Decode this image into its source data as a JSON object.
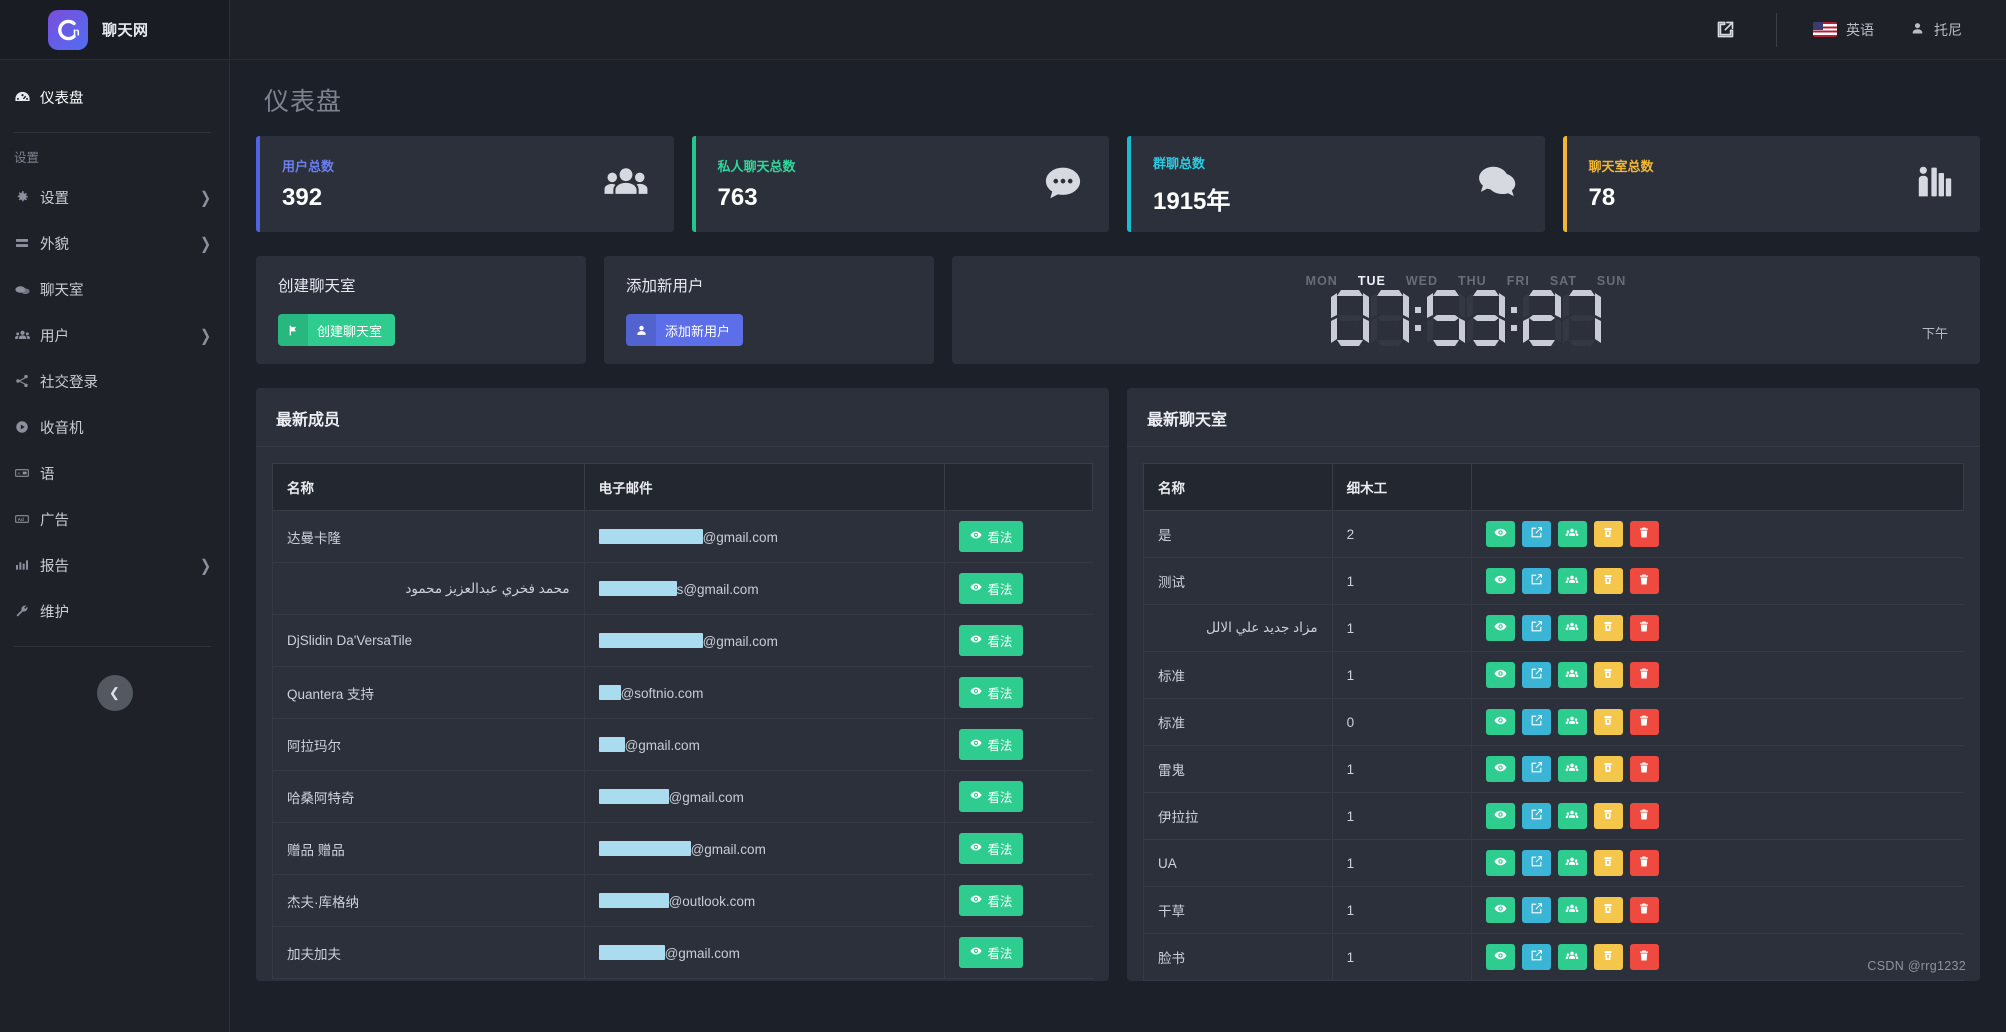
{
  "brand": {
    "title": "聊天网",
    "logo_text": "Cn",
    "logo_icon": "cn-logo-icon"
  },
  "topbar": {
    "external_icon": "external-link-icon",
    "language": "英语",
    "flag_icon": "us-flag-icon",
    "user_icon": "user-avatar-icon",
    "user": "托尼"
  },
  "sidebar": {
    "section_label": "设置",
    "collapse_icon": "chevron-left-icon",
    "items": [
      {
        "label": "仪表盘",
        "icon": "dashboard-icon",
        "active": true,
        "chevron": false
      },
      {
        "label": "设置",
        "icon": "gear-icon",
        "active": false,
        "chevron": true
      },
      {
        "label": "外貌",
        "icon": "appearance-icon",
        "active": false,
        "chevron": true
      },
      {
        "label": "聊天室",
        "icon": "chat-icon",
        "active": false,
        "chevron": false
      },
      {
        "label": "用户",
        "icon": "users-icon",
        "active": false,
        "chevron": true
      },
      {
        "label": "社交登录",
        "icon": "share-icon",
        "active": false,
        "chevron": false
      },
      {
        "label": "收音机",
        "icon": "radio-play-icon",
        "active": false,
        "chevron": false
      },
      {
        "label": "语",
        "icon": "language-icon",
        "active": false,
        "chevron": false
      },
      {
        "label": "广告",
        "icon": "ads-icon",
        "active": false,
        "chevron": false
      },
      {
        "label": "报告",
        "icon": "report-chart-icon",
        "active": false,
        "chevron": true
      },
      {
        "label": "维护",
        "icon": "wrench-icon",
        "active": false,
        "chevron": false
      }
    ]
  },
  "page": {
    "title": "仪表盘"
  },
  "stats": [
    {
      "label": "用户总数",
      "value": "392",
      "accent": "#5064e0",
      "label_color": "#6b7ef0",
      "icon": "group-users-icon"
    },
    {
      "label": "私人聊天总数",
      "value": "763",
      "accent": "#24c68b",
      "label_color": "#2fd79a",
      "icon": "chat-dots-icon"
    },
    {
      "label": "群聊总数",
      "value": "1915年",
      "accent": "#19bcd1",
      "label_color": "#2ccadf",
      "icon": "chat-bubbles-icon"
    },
    {
      "label": "聊天室总数",
      "value": "78",
      "accent": "#f1b733",
      "label_color": "#f5c council",
      "icon": "chat-room-icon"
    }
  ],
  "actions": [
    {
      "title": "创建聊天室",
      "button": "创建聊天室",
      "style": "green",
      "icon": "flag-icon"
    },
    {
      "title": "添加新用户",
      "button": "添加新用户",
      "style": "blue",
      "icon": "user-plus-icon"
    }
  ],
  "clock": {
    "days": [
      "MON",
      "TUE",
      "WED",
      "THU",
      "FRI",
      "SAT",
      "SUN"
    ],
    "active_day": "TUE",
    "time": "07:53:27",
    "hours": "07",
    "minutes": "53",
    "seconds": "27",
    "meridiem": "下午"
  },
  "members_panel": {
    "title": "最新成员",
    "columns": [
      "名称",
      "电子邮件",
      ""
    ],
    "view_label": "看法",
    "view_icon": "eye-icon",
    "rows": [
      {
        "name": "达曼卡隆",
        "redact_w": 104,
        "domain": "@gmail.com"
      },
      {
        "name": "محمد فخري عبدالعزيز محمود",
        "redact_w": 78,
        "domain": "s@gmail.com",
        "rtl": true
      },
      {
        "name": "DjSlidin Da'VersaTile",
        "redact_w": 104,
        "domain": "@gmail.com"
      },
      {
        "name": "Quantera 支持",
        "redact_w": 22,
        "domain": "@softnio.com"
      },
      {
        "name": "阿拉玛尔",
        "redact_w": 26,
        "domain": "@gmail.com"
      },
      {
        "name": "哈桑阿特奇",
        "redact_w": 70,
        "domain": "@gmail.com"
      },
      {
        "name": "赠品 赠品",
        "redact_w": 92,
        "domain": "@gmail.com"
      },
      {
        "name": "杰夫·库格纳",
        "redact_w": 70,
        "domain": "@outlook.com"
      },
      {
        "name": "加夫加夫",
        "redact_w": 66,
        "domain": "@gmail.com"
      }
    ]
  },
  "rooms_panel": {
    "title": "最新聊天室",
    "columns": [
      "名称",
      "细木工",
      ""
    ],
    "action_icons": [
      "eye-icon",
      "edit-square-icon",
      "users-group-icon",
      "archive-trash-icon",
      "delete-trash-icon"
    ],
    "rows": [
      {
        "name": "是",
        "joiner": "2"
      },
      {
        "name": "测试",
        "joiner": "1"
      },
      {
        "name": "مزاد جديد علي الالل",
        "joiner": "1",
        "rtl": true
      },
      {
        "name": "标准",
        "joiner": "1"
      },
      {
        "name": "标准",
        "joiner": "0"
      },
      {
        "name": "雷鬼",
        "joiner": "1"
      },
      {
        "name": "伊拉拉",
        "joiner": "1"
      },
      {
        "name": "UA",
        "joiner": "1"
      },
      {
        "name": "干草",
        "joiner": "1"
      },
      {
        "name": "脸书",
        "joiner": "1"
      }
    ]
  },
  "watermark": "CSDN @rrg1232"
}
